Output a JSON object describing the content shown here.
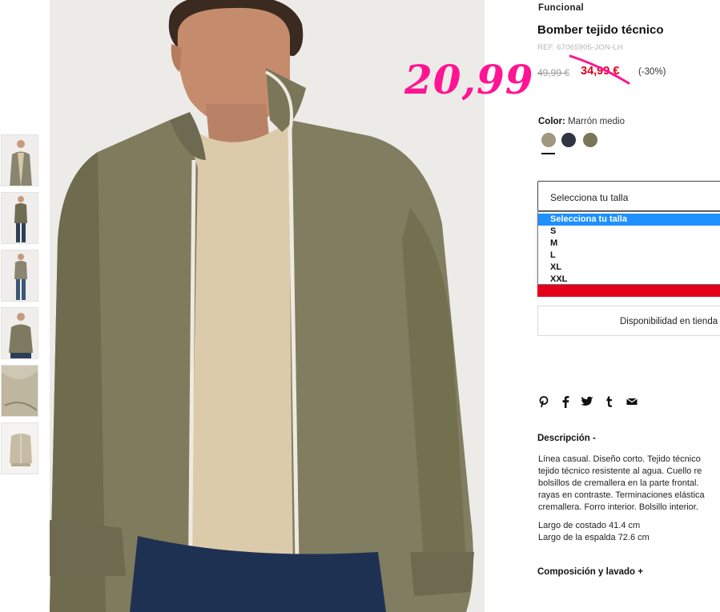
{
  "product": {
    "brand": "Funcional",
    "title": "Bomber tejido técnico",
    "ref": "REF. 67065905-JON-LH",
    "price_original": "49,99 €",
    "price_sale": "34,99 €",
    "discount": "(-30%)",
    "annotation_price": "20,99"
  },
  "color": {
    "label": "Color:",
    "value": "Marrón medio",
    "swatches": [
      "#a09880",
      "#2e3440",
      "#7b7656"
    ]
  },
  "size": {
    "select_label": "Selecciona tu talla",
    "options": [
      "Selecciona tu talla",
      "S",
      "M",
      "L",
      "XL",
      "XXL"
    ],
    "selected_index": 0
  },
  "availability": {
    "label": "Disponibilidad en tienda"
  },
  "share": {
    "icons": [
      "pinterest-icon",
      "facebook-icon",
      "twitter-icon",
      "tumblr-icon",
      "email-icon"
    ]
  },
  "description": {
    "title": "Descripción -",
    "lines": [
      "Línea casual. Diseño corto. Tejido técnico",
      "tejido técnico resistente al agua. Cuello re",
      "bolsillos de cremallera en la parte frontal.",
      "rayas en contraste. Terminaciones elástica",
      "cremallera. Forro interior. Bolsillo interior."
    ],
    "measure_1": "Largo de costado 41.4 cm",
    "measure_2": "Largo de la espalda 72.6 cm"
  },
  "composition": {
    "title": "Composición y lavado +"
  },
  "colors": {
    "accent_red": "#e2001a",
    "annotation_pink": "#ff1493",
    "select_blue": "#1e90ff"
  }
}
